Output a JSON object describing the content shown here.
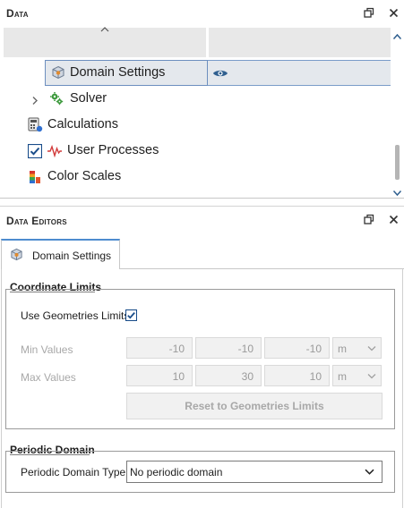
{
  "data_panel": {
    "title": "Data",
    "items": [
      {
        "label": "Domain Settings",
        "icon": "domain-box-icon",
        "visibility_icon": "eye-icon"
      },
      {
        "label": "Solver",
        "icon": "gears-icon",
        "expander": "chevron-right-icon"
      },
      {
        "label": "Calculations",
        "icon": "calculator-icon"
      },
      {
        "label": "User Processes",
        "icon": "waveform-icon",
        "checked": true
      },
      {
        "label": "Color Scales",
        "icon": "color-scales-icon"
      }
    ]
  },
  "editors_panel": {
    "title": "Data Editors",
    "tab_label": "Domain Settings",
    "coordinate_limits": {
      "title": "Coordinate Limits",
      "use_geometries_label": "Use Geometries Limits",
      "use_geometries_checked": true,
      "min_label": "Min Values",
      "min_values": [
        "-10",
        "-10",
        "-10"
      ],
      "min_unit": "m",
      "max_label": "Max Values",
      "max_values": [
        "10",
        "30",
        "10"
      ],
      "max_unit": "m",
      "reset_button": "Reset to Geometries Limits"
    },
    "periodic_domain": {
      "title": "Periodic Domain",
      "type_label": "Periodic Domain Type",
      "type_value": "No periodic domain"
    }
  },
  "colors": {
    "accent": "#4e8ccf",
    "selection": "#e4e8ed",
    "checkbox": "#1a4d8a"
  }
}
